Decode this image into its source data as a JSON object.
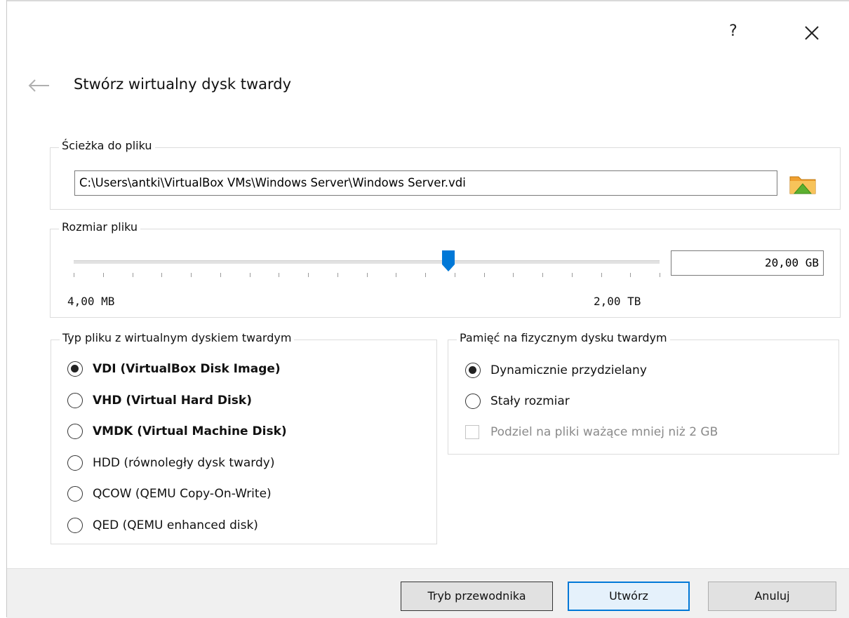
{
  "window": {
    "help_label": "?",
    "title": "Stwórz wirtualny dysk twardy"
  },
  "file_path": {
    "group_title": "Ścieżka do pliku",
    "value": "C:\\Users\\antki\\VirtualBox VMs\\Windows Server\\Windows Server.vdi"
  },
  "file_size": {
    "group_title": "Rozmiar pliku",
    "min_label": "4,00 MB",
    "max_label": "2,00 TB",
    "value": "20,00 GB",
    "slider_position_percent": 64,
    "tick_count": 21
  },
  "file_type": {
    "group_title": "Typ pliku z wirtualnym dyskiem twardym",
    "options": [
      {
        "label": "VDI (VirtualBox Disk Image)",
        "checked": true,
        "bold": true
      },
      {
        "label": "VHD (Virtual Hard Disk)",
        "checked": false,
        "bold": true
      },
      {
        "label": "VMDK (Virtual Machine Disk)",
        "checked": false,
        "bold": true
      },
      {
        "label": "HDD (równoległy dysk twardy)",
        "checked": false,
        "bold": false
      },
      {
        "label": "QCOW (QEMU Copy-On-Write)",
        "checked": false,
        "bold": false
      },
      {
        "label": "QED (QEMU enhanced disk)",
        "checked": false,
        "bold": false
      }
    ]
  },
  "storage": {
    "group_title": "Pamięć na fizycznym dysku twardym",
    "options": [
      {
        "label": "Dynamicznie przydzielany",
        "checked": true
      },
      {
        "label": "Stały rozmiar",
        "checked": false
      }
    ],
    "split_label": "Podziel na pliki ważące mniej niż 2 GB",
    "split_checked": false,
    "split_disabled": true
  },
  "footer": {
    "guided_label": "Tryb przewodnika",
    "create_label": "Utwórz",
    "cancel_label": "Anuluj"
  },
  "icons": {
    "close": "close-icon",
    "back": "back-arrow-icon",
    "folder": "folder-icon",
    "folder_color": "#f0a030",
    "folder_arrow_color": "#5cb030",
    "accent": "#0078d7"
  }
}
